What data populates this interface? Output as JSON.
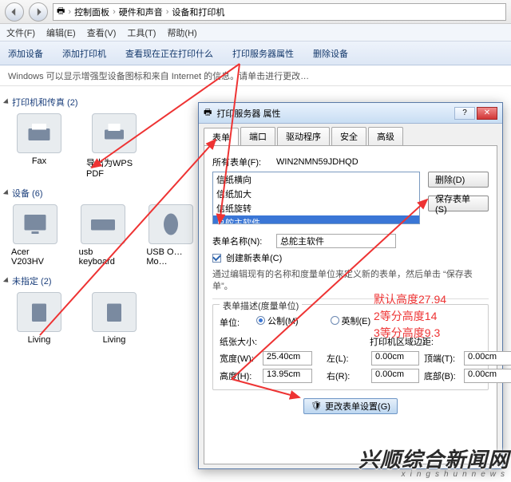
{
  "breadcrumbs": {
    "a": "控制面板",
    "b": "硬件和声音",
    "c": "设备和打印机"
  },
  "menu": {
    "file": "文件(F)",
    "edit": "编辑(E)",
    "view": "查看(V)",
    "tools": "工具(T)",
    "help": "帮助(H)"
  },
  "toolbar": {
    "add_device": "添加设备",
    "add_printer": "添加打印机",
    "see_printing": "查看现在正在打印什么",
    "server_props": "打印服务器属性",
    "remove_device": "删除设备"
  },
  "infobar": "Windows 可以显示增强型设备图标和来自 Internet 的信息。请单击进行更改…",
  "cat": {
    "printers": {
      "label": "打印机和传真 (2)",
      "items": [
        "Fax",
        "导出为WPS PDF"
      ]
    },
    "devices": {
      "label": "设备 (6)",
      "items": [
        "Acer V203HV",
        "usb keyboard",
        "USB O… Mo…"
      ]
    },
    "unspecified": {
      "label": "未指定 (2)",
      "items": [
        "Living",
        "Living"
      ]
    }
  },
  "dialog": {
    "title": "打印服务器 属性",
    "tabs": [
      "表单",
      "端口",
      "驱动程序",
      "安全",
      "高级"
    ],
    "all_forms_label": "所有表单(F):",
    "all_forms_value": "WIN2NMN59JDHQD",
    "list": [
      "信纸横向",
      "信纸加大",
      "信纸旋转",
      "总舵主软件"
    ],
    "btn_delete": "删除(D)",
    "btn_save_form": "保存表单(S)",
    "form_name_label": "表单名称(N):",
    "form_name_value": "总舵主软件",
    "create_new_label": "创建新表单(C)",
    "note1": "通过编辑现有的名称和度量单位来定义新的表单，然后单击 “保存表单”。",
    "group_legend": "表单描述(度量单位)",
    "unit_label": "单位:",
    "unit_metric": "公制(M)",
    "unit_english": "英制(E)",
    "paper_size_label": "纸张大小:",
    "margins_label": "打印机区域边距:",
    "width_label": "宽度(W):",
    "width_value": "25.40cm",
    "height_label": "高度(H):",
    "height_value": "13.95cm",
    "left_label": "左(L):",
    "left_value": "0.00cm",
    "right_label": "右(R):",
    "right_value": "0.00cm",
    "top_label": "顶端(T):",
    "top_value": "0.00cm",
    "bottom_label": "底部(B):",
    "bottom_value": "0.00cm",
    "change_settings_btn": "更改表单设置(G)"
  },
  "annotations": {
    "line1": "默认高度27.94",
    "line2": "2等分高度14",
    "line3": "3等分高度9.3"
  },
  "watermark": {
    "main": "兴顺综合新闻网",
    "sub": "xingshunnews"
  }
}
